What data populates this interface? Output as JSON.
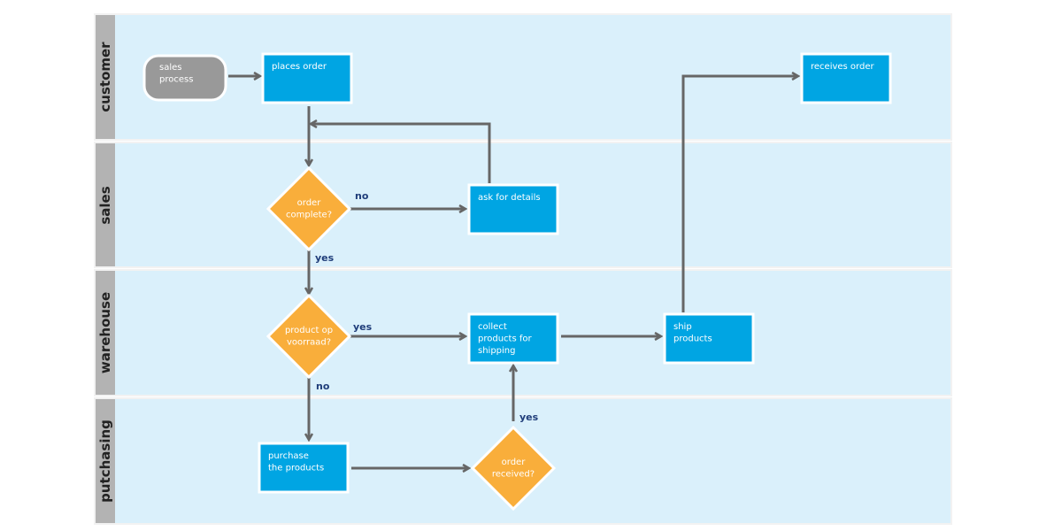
{
  "lanes": [
    {
      "id": "customer",
      "label": "customer"
    },
    {
      "id": "sales",
      "label": "sales"
    },
    {
      "id": "warehouse",
      "label": "warehouse"
    },
    {
      "id": "purchasing",
      "label": "putchasing"
    }
  ],
  "nodes": {
    "start": {
      "type": "terminator",
      "lines": [
        "sales",
        "process"
      ]
    },
    "places_order": {
      "type": "process",
      "lines": [
        "places order"
      ]
    },
    "receives_order": {
      "type": "process",
      "lines": [
        "receives order"
      ]
    },
    "order_complete": {
      "type": "decision",
      "lines": [
        "order",
        "complete?"
      ]
    },
    "ask_details": {
      "type": "process",
      "lines": [
        "ask for details"
      ]
    },
    "product_stock": {
      "type": "decision",
      "lines": [
        "product op",
        "voorraad?"
      ]
    },
    "collect": {
      "type": "process",
      "lines": [
        "collect",
        "products for",
        "shipping"
      ]
    },
    "ship": {
      "type": "process",
      "lines": [
        "ship",
        "products"
      ]
    },
    "purchase": {
      "type": "process",
      "lines": [
        "purchase",
        "the products"
      ]
    },
    "order_received": {
      "type": "decision",
      "lines": [
        "order",
        "received?"
      ]
    }
  },
  "edge_labels": {
    "complete_no": "no",
    "complete_yes": "yes",
    "stock_yes": "yes",
    "stock_no": "no",
    "received_yes": "yes"
  },
  "colors": {
    "process": "#00a5e3",
    "decision": "#f9ae3b",
    "terminator": "#999999",
    "arrow": "#666666",
    "edge_label": "#1f3d7a",
    "lane_bg": "#daf0fb",
    "lane_header": "#b3b3b3"
  }
}
